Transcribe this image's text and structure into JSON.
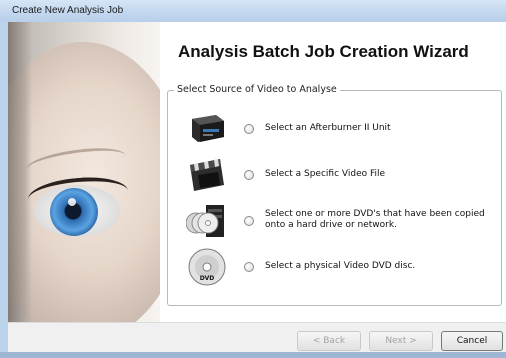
{
  "window": {
    "title": "Create New Analysis Job"
  },
  "wizard": {
    "title": "Analysis Batch Job Creation Wizard"
  },
  "source_group": {
    "legend": "Select Source of Video to Analyse",
    "options": [
      {
        "label": "Select an Afterburner II Unit",
        "icon": "afterburner-unit-icon",
        "selected": false
      },
      {
        "label": "Select a Specific Video File",
        "icon": "video-file-icon",
        "selected": false
      },
      {
        "label_line1": "Select one or more DVD's that have been copied",
        "label_line2": "onto a hard drive or network.",
        "icon": "dvd-stack-drive-icon",
        "selected": false
      },
      {
        "label": "Select a physical Video DVD disc.",
        "icon": "dvd-disc-icon",
        "selected": false
      }
    ]
  },
  "buttons": {
    "back": "< Back",
    "next": "Next >",
    "cancel": "Cancel"
  },
  "icon_disc_text": "DVD"
}
